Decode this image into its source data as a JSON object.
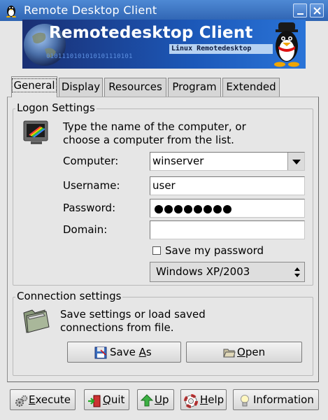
{
  "window": {
    "title": "Remote Desktop Client"
  },
  "banner": {
    "title": "Remotedesktop Client",
    "subtitle": "Linux Remotedesktop",
    "binary_text": "0101110101010101110101"
  },
  "tabs": [
    {
      "label": "General",
      "active": true
    },
    {
      "label": "Display",
      "active": false
    },
    {
      "label": "Resources",
      "active": false
    },
    {
      "label": "Program",
      "active": false
    },
    {
      "label": "Extended",
      "active": false
    }
  ],
  "logon": {
    "section_label": "Logon Settings",
    "description": "Type the name of the computer, or choose a computer from the list.",
    "computer": {
      "label": "Computer:",
      "value": "winserver"
    },
    "username": {
      "label": "Username:",
      "value": "user"
    },
    "password": {
      "label": "Password:",
      "masked_length": 8
    },
    "domain": {
      "label": "Domain:",
      "value": ""
    },
    "save_password": {
      "label": "Save my password",
      "checked": false
    },
    "os_select": {
      "value": "Windows XP/2003"
    }
  },
  "connection": {
    "section_label": "Connection settings",
    "description": "Save settings or load saved connections from file.",
    "save_as": {
      "label": "Save As",
      "underline": "A"
    },
    "open": {
      "label": "Open",
      "underline": "O"
    }
  },
  "bottom_buttons": {
    "execute": {
      "label": "Execute",
      "underline": "E"
    },
    "quit": {
      "label": "Quit",
      "underline": "Q"
    },
    "up": {
      "label": "Up",
      "underline": "U"
    },
    "help": {
      "label": "Help",
      "underline": "H"
    },
    "information": {
      "label": "Information"
    }
  },
  "colors": {
    "titlebar": "#3a72c4",
    "window_bg": "#e6e6e6",
    "banner_dark": "#1a2f73",
    "banner_light": "#2a74d8"
  }
}
